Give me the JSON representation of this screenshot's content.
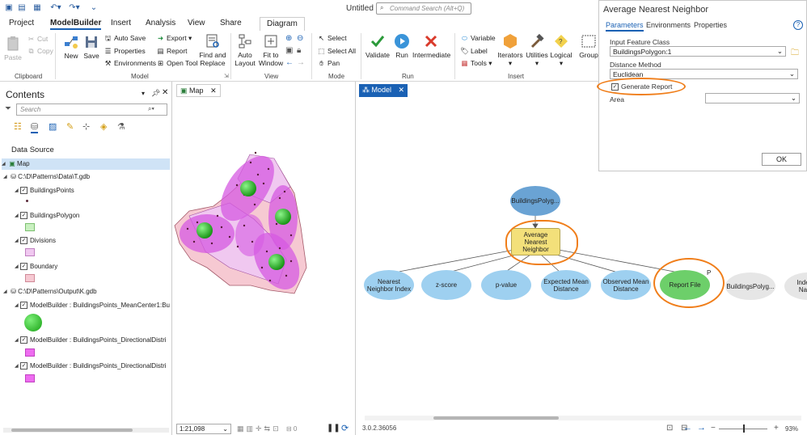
{
  "app": {
    "title": "Untitled",
    "command_search_placeholder": "Command Search (Alt+Q)"
  },
  "ribbon_tabs": [
    "Project",
    "ModelBuilder",
    "Insert",
    "Analysis",
    "View",
    "Share",
    "Diagram"
  ],
  "ribbon": {
    "clipboard": {
      "paste": "Paste",
      "cut": "Cut",
      "copy": "Copy",
      "label": "Clipboard"
    },
    "model": {
      "new": "New",
      "save": "Save",
      "auto_save": "Auto Save",
      "properties": "Properties",
      "environments": "Environments",
      "export": "Export",
      "report": "Report",
      "open_tool": "Open Tool",
      "find_replace": "Find and Replace",
      "label": "Model"
    },
    "view": {
      "auto_layout": "Auto Layout",
      "fit_to_window": "Fit to Window",
      "label": "View"
    },
    "mode": {
      "select": "Select",
      "select_all": "Select All",
      "pan": "Pan",
      "label": "Mode"
    },
    "run": {
      "validate": "Validate",
      "run": "Run",
      "intermediate": "Intermediate",
      "label": "Run"
    },
    "insert": {
      "variable": "Variable",
      "label_item": "Label",
      "tools": "Tools",
      "iterators": "Iterators",
      "utilities": "Utilities",
      "logical": "Logical",
      "group": "Group",
      "label": "Insert"
    }
  },
  "contents": {
    "title": "Contents",
    "search_placeholder": "Search",
    "data_source_label": "Data Source",
    "map_label": "Map",
    "gdb1": "C:\\D\\Patterns\\Data\\T.gdb",
    "layers1": [
      "BuildingsPoints",
      "BuildingsPolygon",
      "Divisions",
      "Boundary"
    ],
    "gdb2": "C:\\D\\Patterns\\Output\\K.gdb",
    "layers2": [
      "ModelBuilder : BuildingsPoints_MeanCenter1:Bui",
      "ModelBuilder : BuildingsPoints_DirectionalDistri",
      "ModelBuilder : BuildingsPoints_DirectionalDistri"
    ]
  },
  "map": {
    "tab_label": "Map",
    "scale": "1:21,098"
  },
  "model": {
    "tab_label": "Model",
    "nodes": {
      "input": "BuildingsPolyg...",
      "tool": "Average Nearest Neighbor",
      "outputs": [
        "Nearest Neighbor Index",
        "z-score",
        "p-value",
        "Expected Mean Distance",
        "Observed Mean Distance",
        "Report File",
        "BuildingsPolyg...",
        "Inde Na"
      ],
      "report_badge": "P"
    },
    "status_version": "3.0.2.36056",
    "zoom": "93%"
  },
  "params_panel": {
    "title": "Average Nearest Neighbor",
    "tabs": [
      "Parameters",
      "Environments",
      "Properties"
    ],
    "input_label": "Input Feature Class",
    "input_value": "BuildingsPolygon:1",
    "distance_label": "Distance Method",
    "distance_value": "Euclidean",
    "generate_report_label": "Generate Report",
    "generate_report_checked": true,
    "area_label": "Area",
    "area_value": "",
    "ok_label": "OK"
  },
  "colors": {
    "accent": "#1a61b4",
    "tool_fill": "#f3e07a",
    "input_fill": "#6aa3d4",
    "output_fill": "#9ed0f0",
    "report_fill": "#6dcf6a",
    "highlight": "#f07e1a",
    "map_magenta": "#d65ae2",
    "map_green": "#22b51f"
  }
}
